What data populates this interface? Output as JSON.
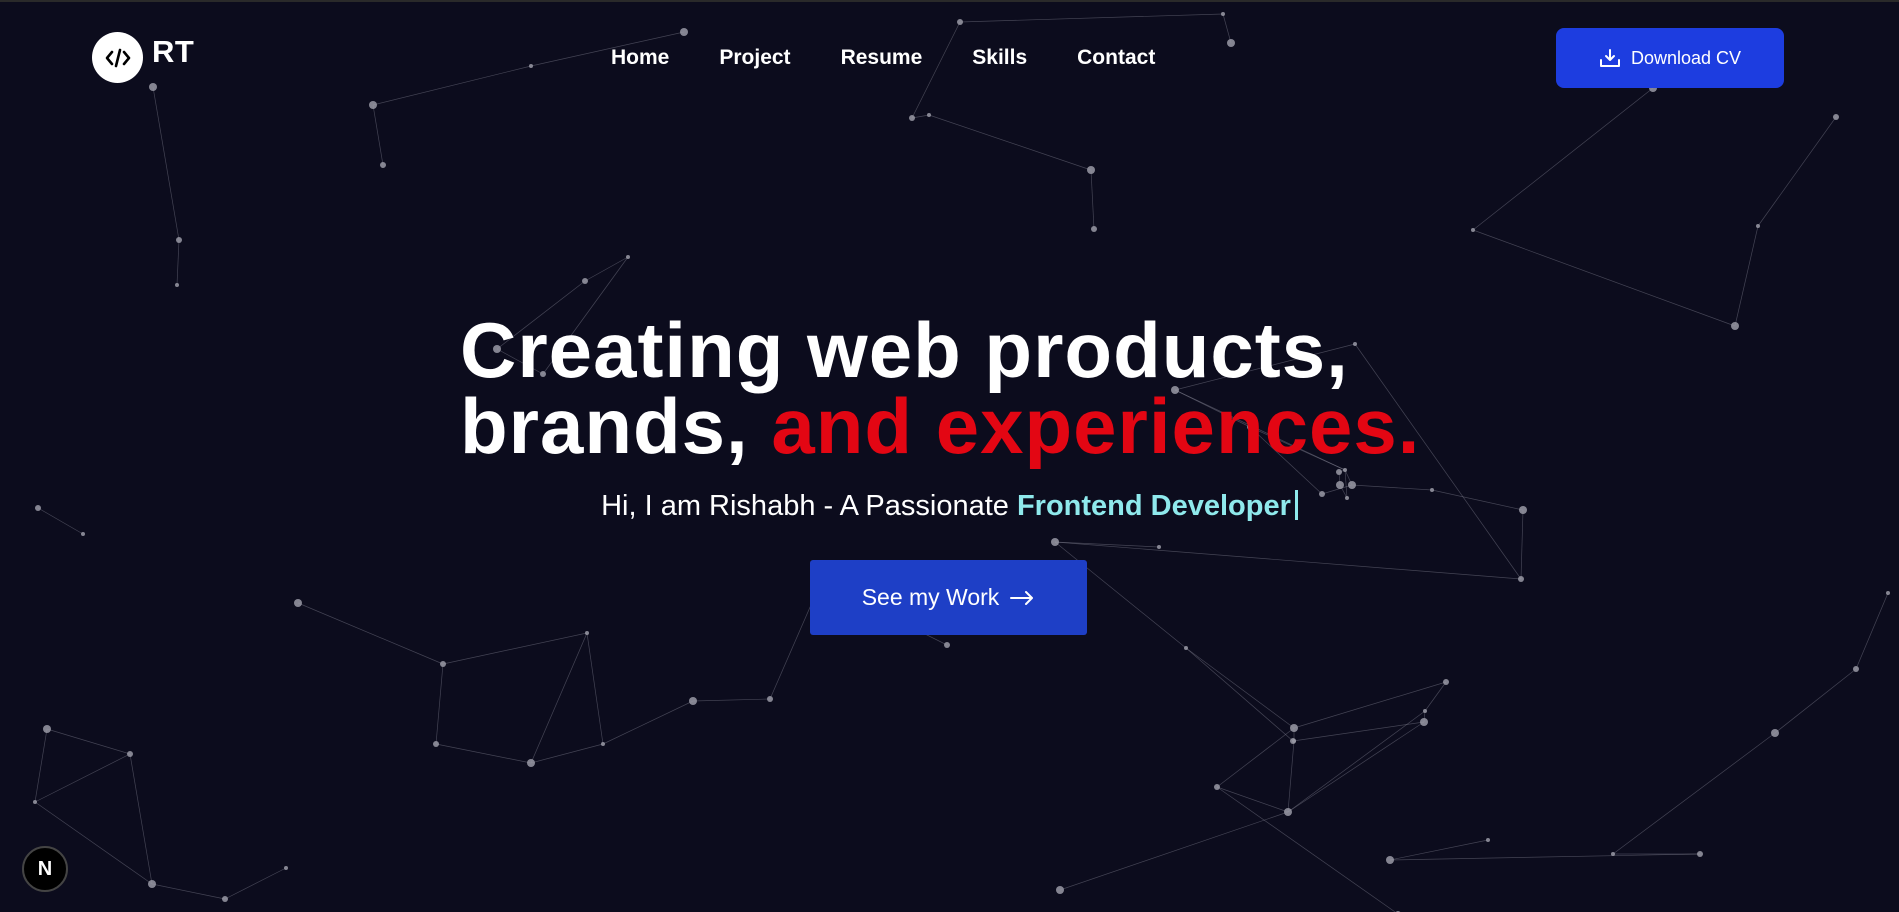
{
  "nav": {
    "logo_text": "RT",
    "logo_icon": "code-icon",
    "menu": [
      {
        "label": "Home"
      },
      {
        "label": "Project"
      },
      {
        "label": "Resume"
      },
      {
        "label": "Skills"
      },
      {
        "label": "Contact"
      }
    ],
    "download_label": "Download CV",
    "download_icon": "download-icon"
  },
  "hero": {
    "title_line1": "Creating web products,",
    "title_line2_white": "brands, ",
    "title_line2_red": "and experiences.",
    "intro": "Hi, I am Rishabh - A Passionate ",
    "role": "Frontend Developer",
    "cta_label": "See my Work",
    "cta_icon": "arrow-right-icon"
  },
  "badge": {
    "label": "N",
    "icon": "nextjs-logo-icon"
  },
  "colors": {
    "background": "#0c0c1d",
    "accent_blue": "#1d3de0",
    "accent_red": "#e30613",
    "accent_cyan": "#8fe9ec"
  }
}
